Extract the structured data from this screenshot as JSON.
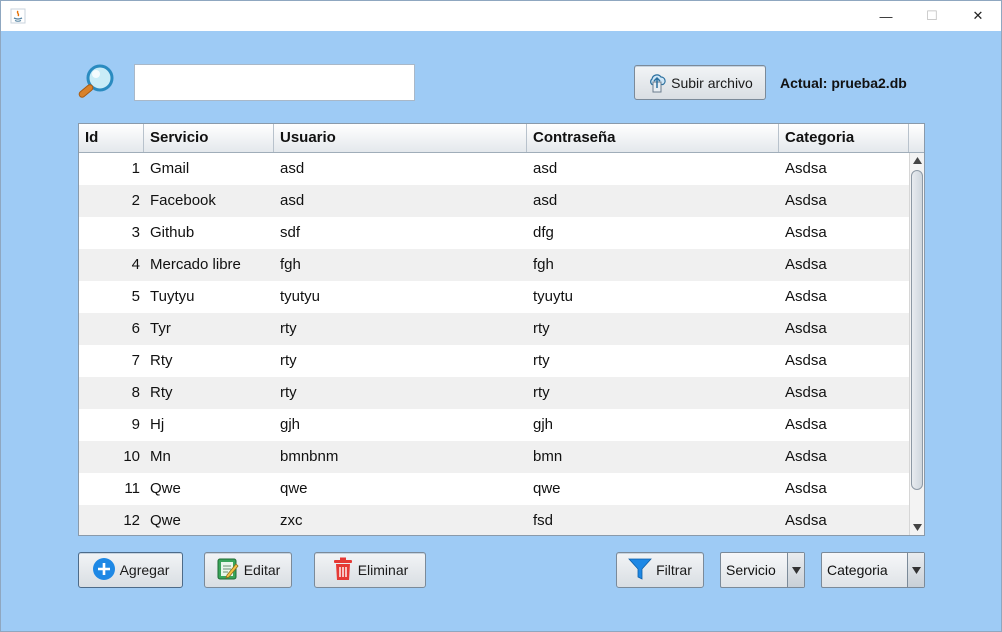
{
  "window": {
    "minimize_glyph": "—",
    "maximize_glyph": "☐",
    "close_glyph": "✕"
  },
  "toolbar": {
    "search_value": "",
    "upload_label": "Subir archivo",
    "current_file": "Actual: prueba2.db"
  },
  "table": {
    "columns": [
      "Id",
      "Servicio",
      "Usuario",
      "Contraseña",
      "Categoria"
    ],
    "rows": [
      [
        "1",
        "Gmail",
        "asd",
        "asd",
        "Asdsa"
      ],
      [
        "2",
        "Facebook",
        "asd",
        "asd",
        "Asdsa"
      ],
      [
        "3",
        "Github",
        "sdf",
        "dfg",
        "Asdsa"
      ],
      [
        "4",
        "Mercado libre",
        "fgh",
        "fgh",
        "Asdsa"
      ],
      [
        "5",
        "Tuytyu",
        "tyutyu",
        "tyuytu",
        "Asdsa"
      ],
      [
        "6",
        "Tyr",
        "rty",
        "rty",
        "Asdsa"
      ],
      [
        "7",
        "Rty",
        "rty",
        "rty",
        "Asdsa"
      ],
      [
        "8",
        "Rty",
        "rty",
        "rty",
        "Asdsa"
      ],
      [
        "9",
        "Hj",
        "gjh",
        "gjh",
        "Asdsa"
      ],
      [
        "10",
        "Mn",
        "bmnbnm",
        "bmn",
        "Asdsa"
      ],
      [
        "11",
        "Qwe",
        "qwe",
        "qwe",
        "Asdsa"
      ],
      [
        "12",
        "Qwe",
        "zxc",
        "fsd",
        "Asdsa"
      ]
    ]
  },
  "actions": {
    "add_label": "Agregar",
    "edit_label": "Editar",
    "delete_label": "Eliminar",
    "filter_label": "Filtrar"
  },
  "filters": {
    "service_selected": "Servicio",
    "category_selected": "Categoria"
  },
  "icons": {
    "search": "magnifier-icon",
    "upload": "cloud-upload-icon",
    "add": "plus-circle-icon",
    "edit": "edit-notepad-icon",
    "delete": "trash-icon",
    "filter": "funnel-icon"
  },
  "colors": {
    "background": "#9ecbf5",
    "add_blue": "#1e88e5",
    "delete_red": "#e53935",
    "filter_blue": "#1e88e5"
  }
}
